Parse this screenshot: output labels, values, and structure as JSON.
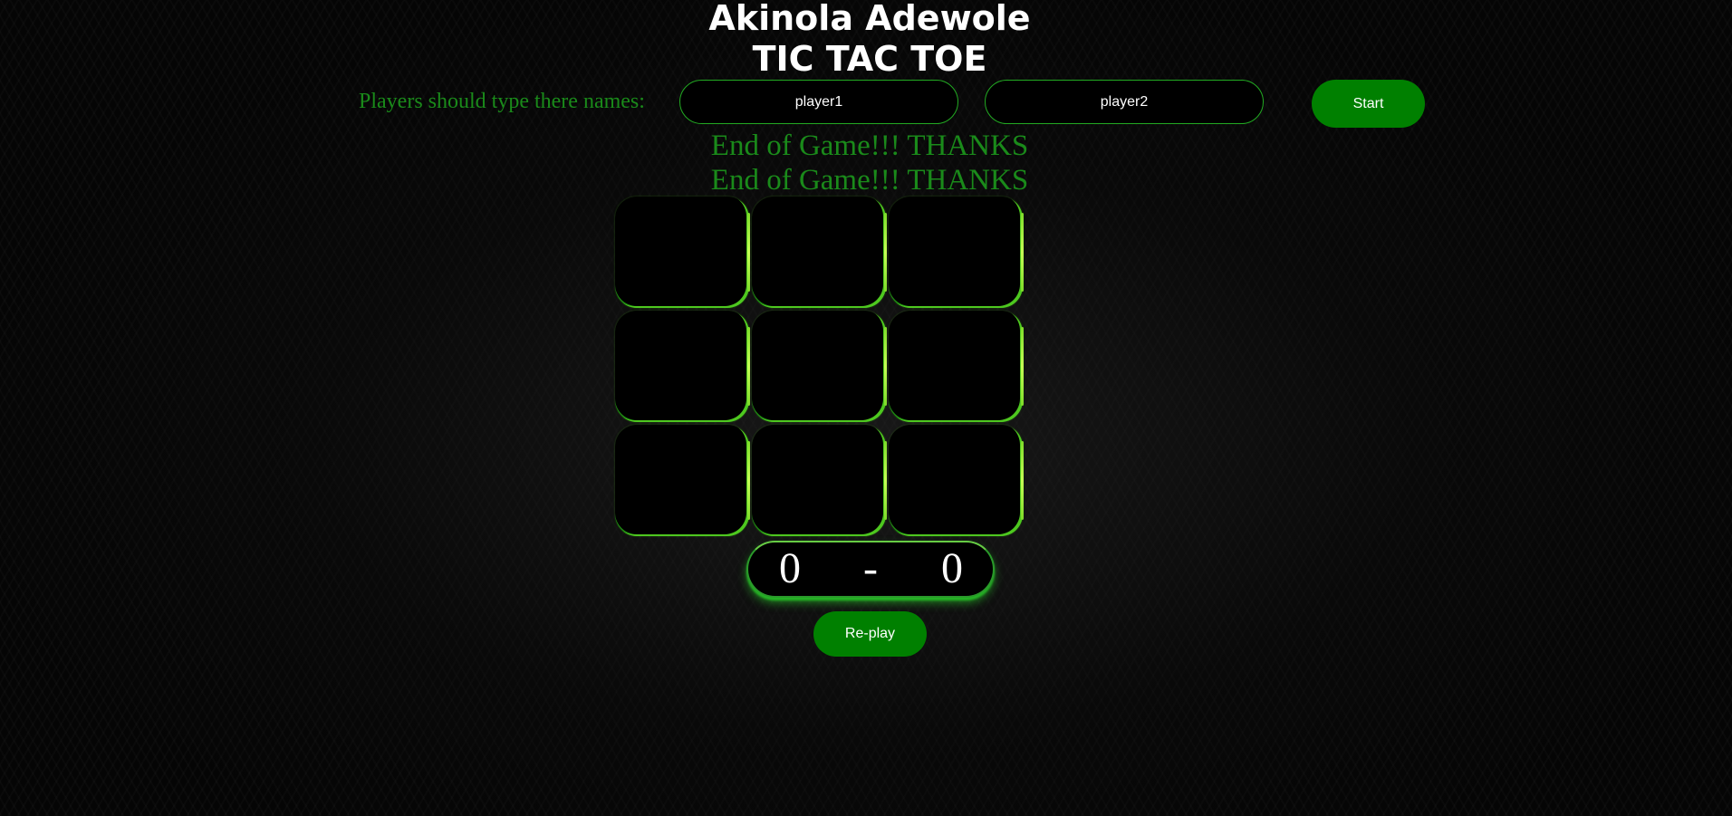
{
  "header": {
    "author": "Akinola Adewole",
    "title": "TIC TAC TOE"
  },
  "players": {
    "label": "Players should type there names:",
    "player1_placeholder": "player1",
    "player2_placeholder": "player2",
    "start_label": "Start"
  },
  "messages": [
    "End of Game!!! THANKS",
    "End of Game!!! THANKS"
  ],
  "board": {
    "cells": [
      "",
      "",
      "",
      "",
      "",
      "",
      "",
      "",
      ""
    ]
  },
  "score": {
    "player1": "0",
    "separator": "-",
    "player2": "0"
  },
  "replay_label": "Re-play",
  "colors": {
    "accent_green": "#008000",
    "message_green": "#1a8a1a",
    "glow_green": "#c6ff55"
  }
}
